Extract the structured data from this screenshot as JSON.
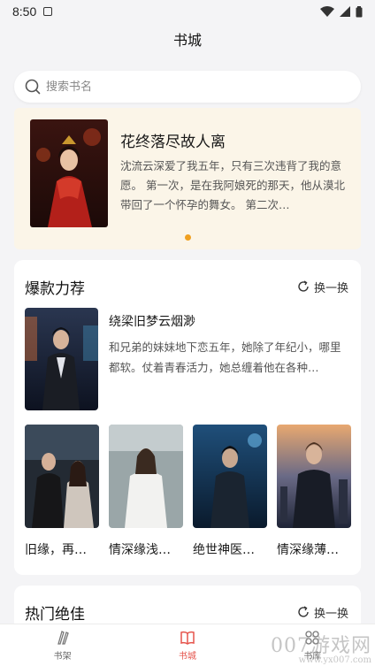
{
  "status_bar": {
    "time": "8:50"
  },
  "header": {
    "title": "书城"
  },
  "search": {
    "placeholder": "搜索书名"
  },
  "banner": {
    "title": "花终落尽故人离",
    "description": "沈流云深爱了我五年，只有三次违背了我的意愿。 第一次，是在我阿娘死的那天，他从漠北带回了一个怀孕的舞女。 第二次…",
    "accent_color": "#f0a020"
  },
  "hot_picks": {
    "title": "爆款力荐",
    "swap_label": "换一换",
    "featured": {
      "title": "绕梁旧梦云烟渺",
      "description": "和兄弟的妹妹地下恋五年，她除了年纪小，哪里都软。仗着青春活力，她总缠着他在各种…"
    },
    "books": [
      {
        "title": "旧缘，再…"
      },
      {
        "title": "情深缘浅…"
      },
      {
        "title": "绝世神医…"
      },
      {
        "title": "情深缘薄…"
      }
    ]
  },
  "popular": {
    "title": "热门绝佳",
    "swap_label": "换一换"
  },
  "tabbar": {
    "items": [
      {
        "label": "书架",
        "icon": "bookshelf-icon"
      },
      {
        "label": "书城",
        "icon": "book-open-icon",
        "active": true
      },
      {
        "label": "书库",
        "icon": "grid-icon"
      }
    ],
    "active_color": "#e5534b"
  },
  "watermark": {
    "brand": "007游戏网",
    "url": "www.yx007.com"
  }
}
